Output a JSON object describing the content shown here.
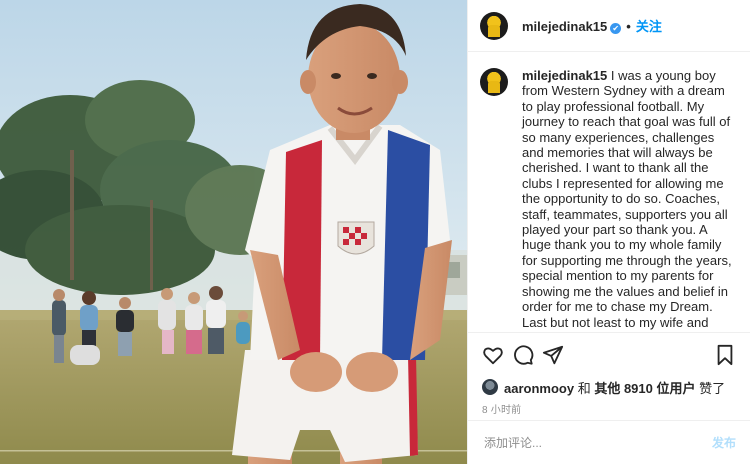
{
  "post": {
    "username": "milejedinak15",
    "verified_badge": "✔",
    "follow_separator": "•",
    "follow_label": "关注"
  },
  "caption": {
    "username": "milejedinak15",
    "text": "I was a young boy from Western Sydney with a dream to play professional football. My journey to reach that goal was full of so many experiences, challenges and memories that will always be cherished. I want to thank all the clubs I represented for allowing me the opportunity to do so. Coaches, staff, teammates, supporters you all played your part so thank you. A huge thank you to my whole family for supporting me through the years, special mention to my parents for showing me the values and belief in order for me to chase my Dream. Last but not least to my wife and children thank you for being my biggest fans"
  },
  "actions": {
    "like_icon": "heart-icon",
    "comment_icon": "comment-icon",
    "share_icon": "share-icon",
    "save_icon": "bookmark-icon"
  },
  "likes": {
    "liker": "aaronmooy",
    "middle": " 和 ",
    "others_prefix": "其他 ",
    "count": "8910",
    "others_suffix": " 位用户",
    "tail": " 赞了"
  },
  "timestamp": "8 小时前",
  "comment": {
    "placeholder": "添加评论...",
    "post_label": "发布"
  },
  "colors": {
    "accent_blue": "#0095f6",
    "verified_blue": "#3897f0",
    "jersey_red": "#c8283a",
    "jersey_blue": "#2b4ea3",
    "sky": "#cfe2ef",
    "grass": "#a9a25a"
  }
}
